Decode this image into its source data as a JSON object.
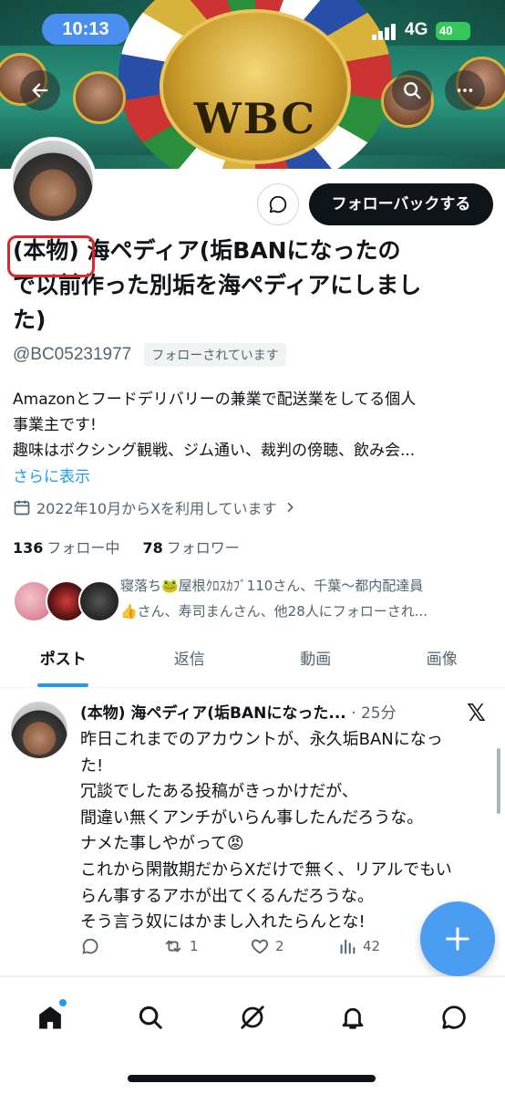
{
  "status_bar": {
    "time": "10:13",
    "network": "4G",
    "battery": "40"
  },
  "banner": {
    "belt_text": "WBC"
  },
  "profile": {
    "message_button_icon": "chat-bubble-icon",
    "follow_back_label": "フォローバックする",
    "name_line1": "(本物) 海ペディア(垢BANになったの",
    "name_line2": "で以前作った別垢を海ペディアにしまし",
    "name_line3": "た)",
    "handle": "@BC05231977",
    "follows_you": "フォローされています",
    "bio_line1": "Amazonとフードデリバリーの兼業で配送業をしてる個人",
    "bio_line2": "事業主です!",
    "bio_line3": "趣味はボクシング観戦、ジム通い、裁判の傍聴、飲み会...",
    "show_more": "さらに表示",
    "joined": "2022年10月からXを利用しています",
    "following_count": "136",
    "following_label": "フォロー中",
    "followers_count": "78",
    "followers_label": "フォロワー",
    "followed_by_line1": "寝落ち🐸屋根ｸﾛｽｶﾌﾞ110さん、千葉〜都内配達員",
    "followed_by_line2": "👍さん、寿司まんさん、他28人にフォローされ..."
  },
  "tabs": [
    {
      "label": "ポスト",
      "active": true
    },
    {
      "label": "返信",
      "active": false
    },
    {
      "label": "動画",
      "active": false
    },
    {
      "label": "画像",
      "active": false
    }
  ],
  "tweet": {
    "author": "(本物) 海ペディア(垢BANになった...",
    "time": "· 25分",
    "lines": [
      "昨日これまでのアカウントが、永久垢BANになっ",
      "た!",
      "冗談でしたある投稿がきっかけだが、",
      "間違い無くアンチがいらん事したんだろうな。",
      "ナメた事しやがって😡",
      "これから閑散期だからXだけで無く、リアルでもい",
      "らん事するアホが出てくるんだろうな。",
      "そう言う奴にはかまし入れたらんとな!"
    ],
    "retweets": "1",
    "likes": "2",
    "views": "42"
  },
  "bottom_nav": [
    "home-icon",
    "search-icon",
    "grok-icon",
    "notifications-icon",
    "messages-icon"
  ],
  "colors": {
    "accent": "#1d9bf0",
    "fab": "#4a9df0",
    "highlight": "#e0262a"
  }
}
